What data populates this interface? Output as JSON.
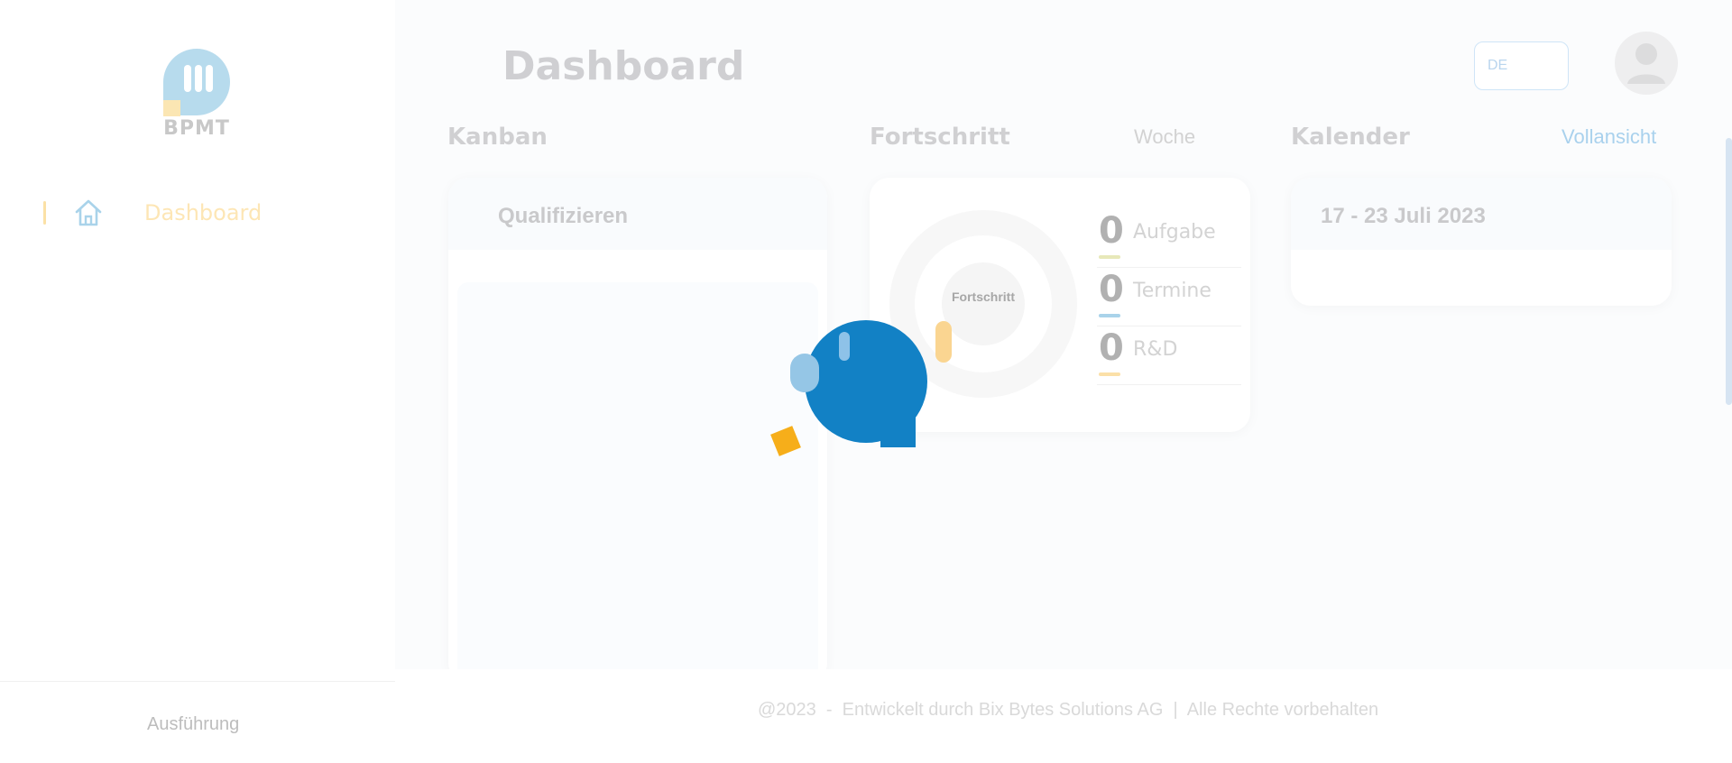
{
  "app": {
    "logo_text": "BPMT"
  },
  "sidebar": {
    "items": [
      {
        "label": "Dashboard",
        "icon": "home-icon",
        "active": true
      }
    ],
    "footer_label": "Ausführung"
  },
  "header": {
    "title": "Dashboard",
    "language": "DE"
  },
  "kanban": {
    "title": "Kanban",
    "column_title": "Qualifizieren"
  },
  "progress": {
    "title": "Fortschritt",
    "period_label": "Woche",
    "ring_label": "Fortschritt",
    "stats": [
      {
        "value": "0",
        "label": "Aufgabe",
        "color": "#e7e8b9"
      },
      {
        "value": "0",
        "label": "Termine",
        "color": "#a9d3ea"
      },
      {
        "value": "0",
        "label": "R&D",
        "color": "#fbe0a8"
      }
    ]
  },
  "calendar": {
    "title": "Kalender",
    "link_label": "Vollansicht",
    "date_range": "17 - 23 Juli 2023"
  },
  "footer": {
    "text": "@2023  -  Entwickelt durch Bix Bytes Solutions AG  |  Alle Rechte vorbehalten"
  },
  "colors": {
    "brand_blue": "#1281c5",
    "brand_light_blue": "#b7dbed",
    "brand_yellow": "#f6ae1a",
    "link_blue": "#a9d1ed"
  }
}
